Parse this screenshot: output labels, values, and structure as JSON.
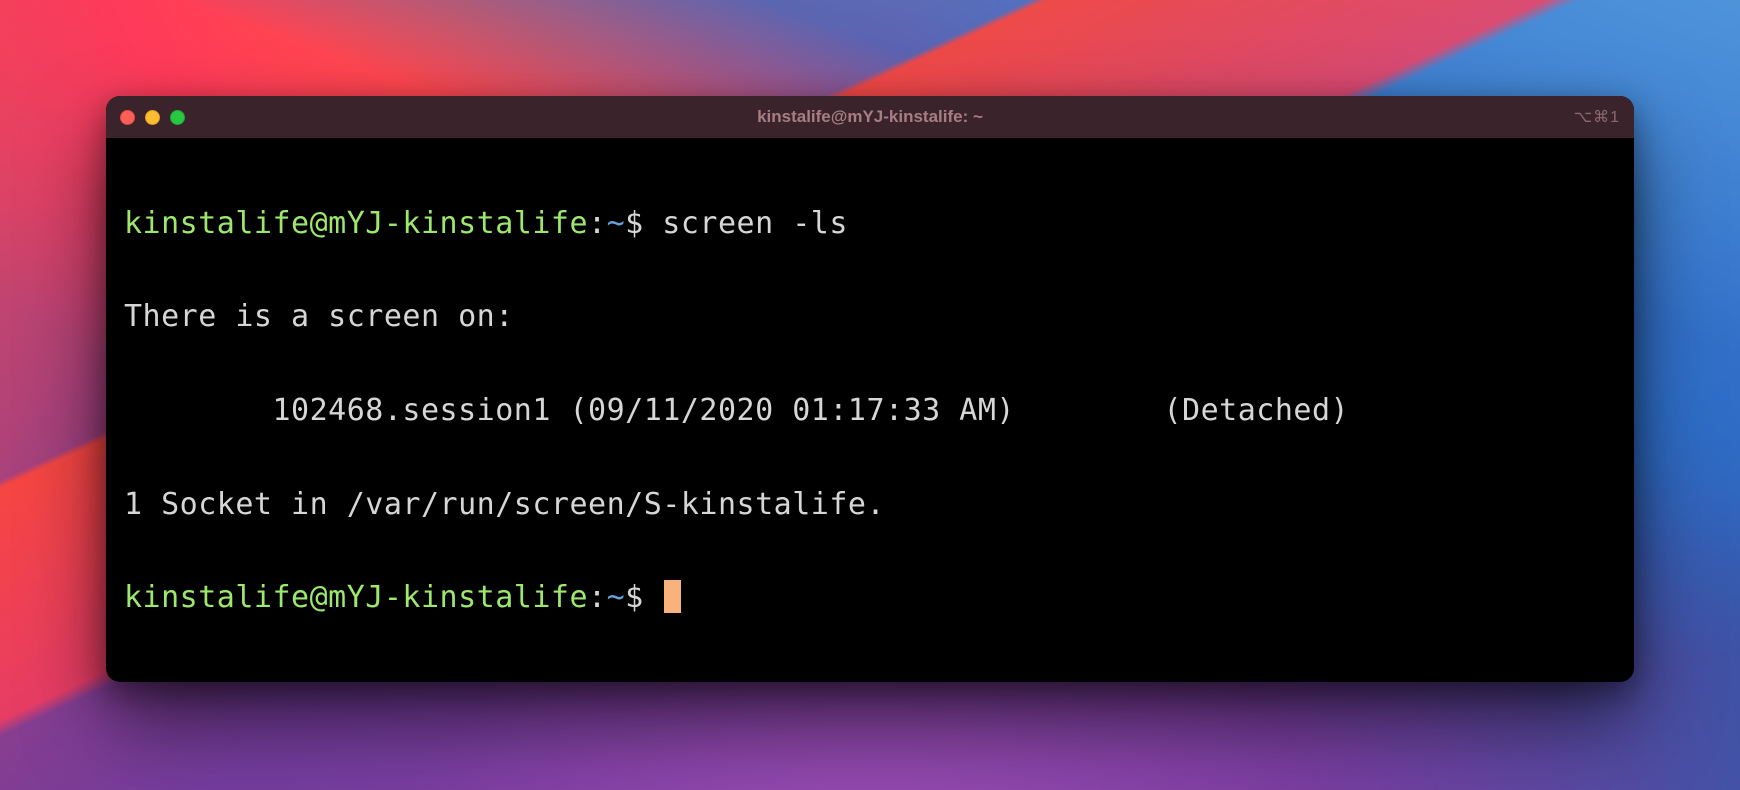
{
  "titlebar": {
    "title": "kinstalife@mYJ-kinstalife: ~",
    "shortcut": "⌥⌘1"
  },
  "prompt": {
    "user_host": "kinstalife@mYJ-kinstalife",
    "separator": ":",
    "path": "~",
    "dollar": "$"
  },
  "command": "screen -ls",
  "output": {
    "header": "There is a screen on:",
    "session_indent": "        ",
    "session_name": "102468.session1 (09/11/2020 01:17:33 AM)",
    "session_gap": "        ",
    "session_status": "(Detached)",
    "socket_line": "1 Socket in /var/run/screen/S-kinstalife."
  }
}
